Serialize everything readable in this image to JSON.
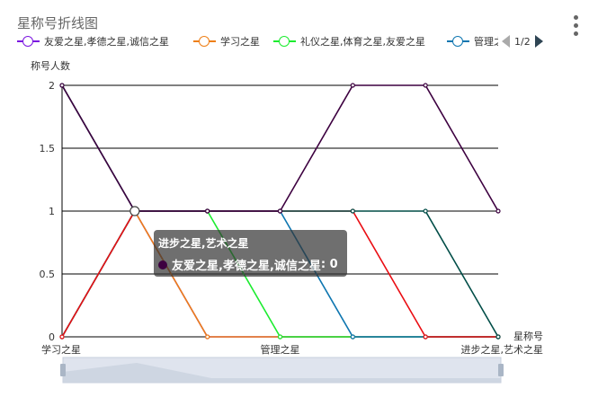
{
  "chart": {
    "title": "星称号折线图",
    "ylabel": "称号人数",
    "xlabel": "星称号",
    "pager": "1/2",
    "tooltip": {
      "title": "进步之星,艺术之星",
      "series": "友爱之星,孝德之星,诚信之星",
      "value": "0"
    }
  },
  "chart_data": {
    "type": "line",
    "categories": [
      "学习之星",
      "",
      "",
      "管理之星",
      "",
      "",
      "进步之星,艺术之星"
    ],
    "visible_category_labels": [
      "学习之星",
      "管理之星",
      "进步之星,艺术之星"
    ],
    "yticks": [
      "0",
      "0.5",
      "1",
      "1.5",
      "2"
    ],
    "ylim": [
      0,
      2
    ],
    "grid": true,
    "legend_position": "top",
    "series": [
      {
        "name": "友爱之星,孝德之星,诚信之星",
        "color": "#7b16e0",
        "values": [
          0,
          1,
          0,
          0,
          0,
          0,
          0
        ]
      },
      {
        "name": "学习之星",
        "color": "#ee7f17",
        "values": [
          0,
          1,
          0,
          0,
          0,
          0,
          0
        ]
      },
      {
        "name": "礼仪之星,体育之星,友爱之星",
        "color": "#1cec2f",
        "values": [
          0,
          1,
          1,
          0,
          0,
          0,
          0
        ]
      },
      {
        "name": "管理之星",
        "color": "#0e76b0",
        "values": [
          0,
          1,
          1,
          1,
          0,
          0,
          0
        ]
      },
      {
        "name": "",
        "color": "#ea0d13",
        "values": [
          0,
          1,
          1,
          1,
          1,
          0,
          0
        ]
      },
      {
        "name": "",
        "color": "#004d47",
        "values": [
          2,
          1,
          1,
          1,
          1,
          1,
          0
        ]
      },
      {
        "name": "",
        "color": "#3d0040",
        "values": [
          2,
          1,
          1,
          1,
          2,
          2,
          1
        ]
      }
    ]
  }
}
